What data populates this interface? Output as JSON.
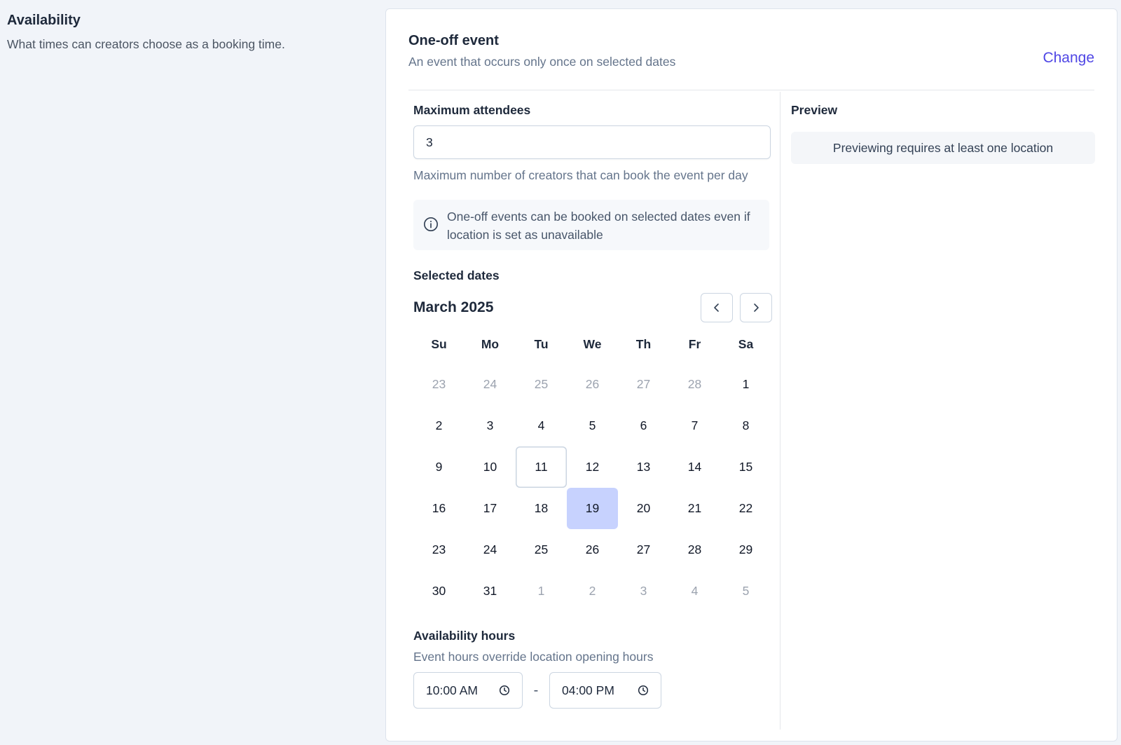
{
  "availability": {
    "title": "Availability",
    "description": "What times can creators choose as a booking time."
  },
  "event": {
    "title": "One-off event",
    "description": "An event that occurs only once on selected dates",
    "change_label": "Change"
  },
  "max_attendees": {
    "label": "Maximum attendees",
    "value": "3",
    "help": "Maximum number of creators that can book the event per day"
  },
  "info": {
    "icon": "info-icon",
    "text": "One-off events can be booked on selected dates even if location is set as unavailable"
  },
  "calendar": {
    "label": "Selected dates",
    "month": "March 2025",
    "weekdays": [
      "Su",
      "Mo",
      "Tu",
      "We",
      "Th",
      "Fr",
      "Sa"
    ],
    "weeks": [
      [
        {
          "d": "23",
          "out": true
        },
        {
          "d": "24",
          "out": true
        },
        {
          "d": "25",
          "out": true
        },
        {
          "d": "26",
          "out": true
        },
        {
          "d": "27",
          "out": true
        },
        {
          "d": "28",
          "out": true
        },
        {
          "d": "1"
        }
      ],
      [
        {
          "d": "2"
        },
        {
          "d": "3"
        },
        {
          "d": "4"
        },
        {
          "d": "5"
        },
        {
          "d": "6"
        },
        {
          "d": "7"
        },
        {
          "d": "8"
        }
      ],
      [
        {
          "d": "9"
        },
        {
          "d": "10"
        },
        {
          "d": "11",
          "today": true
        },
        {
          "d": "12"
        },
        {
          "d": "13"
        },
        {
          "d": "14"
        },
        {
          "d": "15"
        }
      ],
      [
        {
          "d": "16"
        },
        {
          "d": "17"
        },
        {
          "d": "18"
        },
        {
          "d": "19",
          "selected": true
        },
        {
          "d": "20"
        },
        {
          "d": "21"
        },
        {
          "d": "22"
        }
      ],
      [
        {
          "d": "23"
        },
        {
          "d": "24"
        },
        {
          "d": "25"
        },
        {
          "d": "26"
        },
        {
          "d": "27"
        },
        {
          "d": "28"
        },
        {
          "d": "29"
        }
      ],
      [
        {
          "d": "30"
        },
        {
          "d": "31"
        },
        {
          "d": "1",
          "out": true
        },
        {
          "d": "2",
          "out": true
        },
        {
          "d": "3",
          "out": true
        },
        {
          "d": "4",
          "out": true
        },
        {
          "d": "5",
          "out": true
        }
      ]
    ]
  },
  "hours": {
    "label": "Availability hours",
    "help": "Event hours override location opening hours",
    "start": "10:00 AM",
    "separator": "-",
    "end": "04:00 PM"
  },
  "preview": {
    "label": "Preview",
    "message": "Previewing requires at least one location"
  },
  "colors": {
    "accent": "#4f46e5",
    "selected_day": "#c7d2fe",
    "background": "#f1f4f9"
  }
}
